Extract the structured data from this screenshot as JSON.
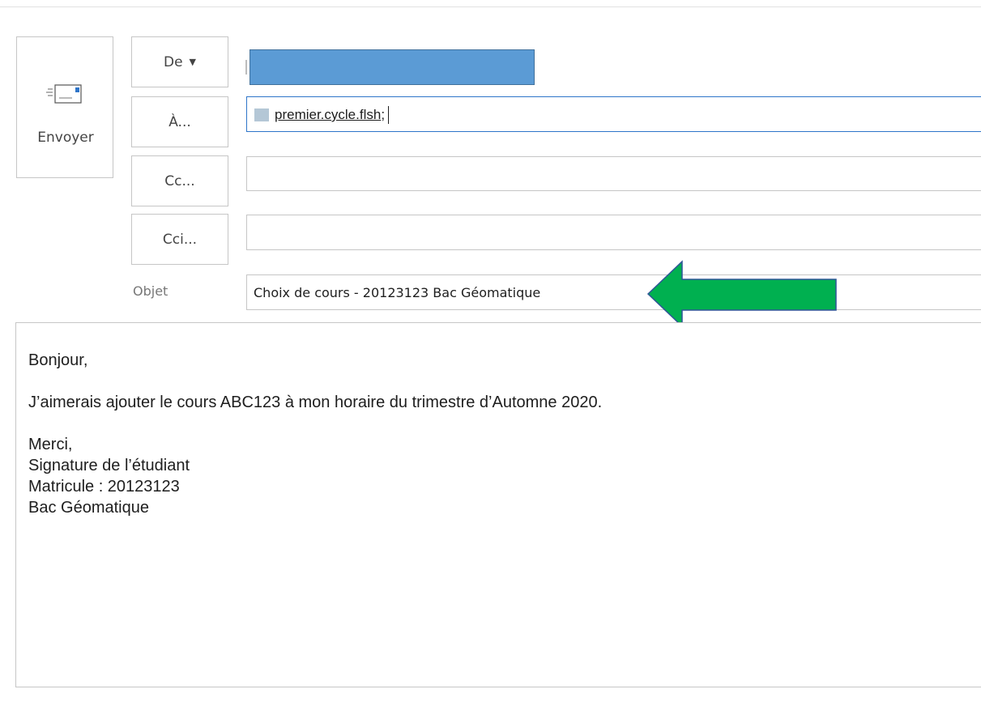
{
  "compose": {
    "send_label": "Envoyer",
    "from_label": "De",
    "to_label": "À...",
    "cc_label": "Cc...",
    "bcc_label": "Cci...",
    "subject_label": "Objet",
    "to_recipient": "premier.cycle.flsh",
    "to_separator": ";",
    "cc_value": "",
    "bcc_value": "",
    "subject_value": "Choix de cours - 20123123 Bac Géomatique"
  },
  "message": {
    "greeting": "Bonjour,",
    "line1": "J’aimerais ajouter le cours ABC123 à mon horaire du trimestre d’Automne 2020.",
    "closing": "Merci,",
    "signature": "Signature de l’étudiant",
    "matricule": "Matricule : 20123123",
    "program": "Bac Géomatique"
  },
  "colors": {
    "redaction_fill": "#5b9bd5",
    "annotation_arrow": "#00b050",
    "focus_border": "#2e75c9"
  },
  "icons": {
    "send": "envelope-send-icon",
    "from_dropdown": "chevron-down-icon",
    "annotation": "arrow-left-icon"
  }
}
